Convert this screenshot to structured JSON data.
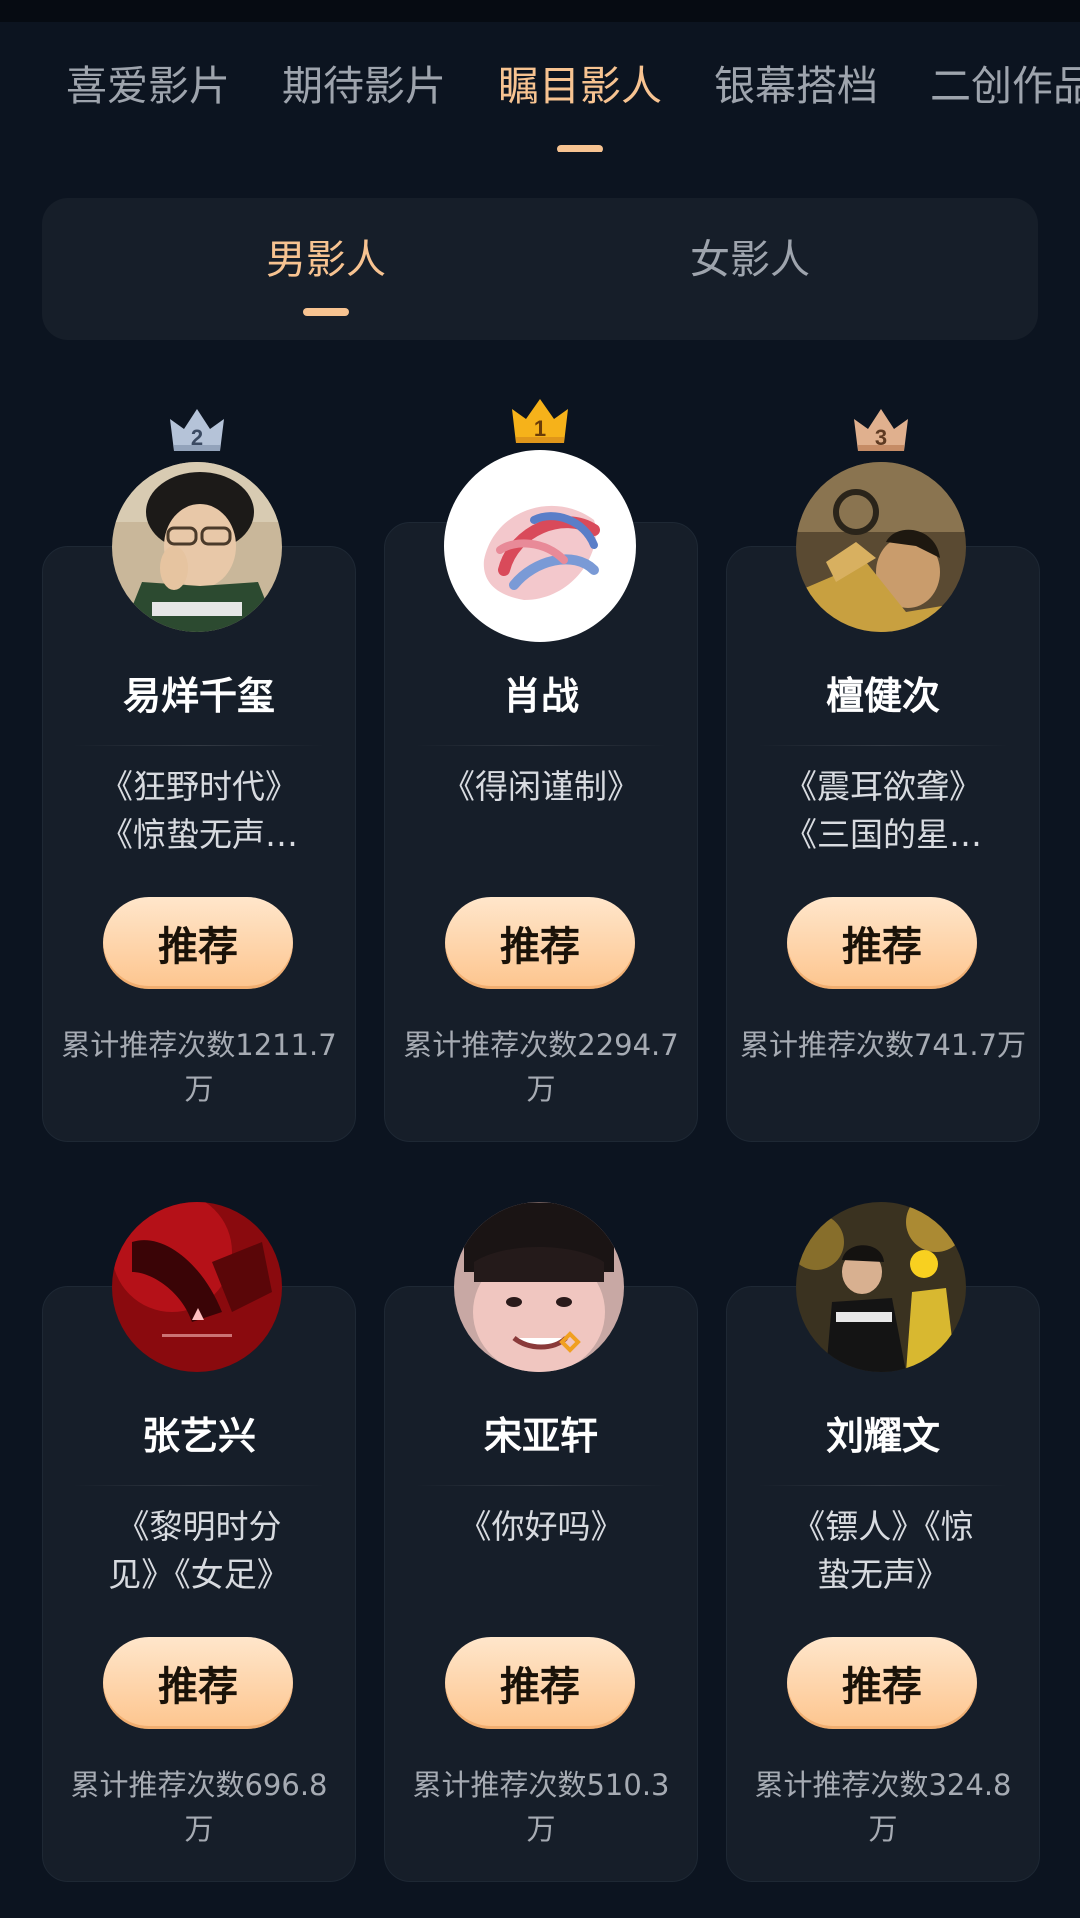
{
  "top_tabs": [
    {
      "label": "喜爱影片",
      "active": false
    },
    {
      "label": "期待影片",
      "active": false
    },
    {
      "label": "瞩目影人",
      "active": true
    },
    {
      "label": "银幕搭档",
      "active": false
    },
    {
      "label": "二创作品",
      "active": false
    }
  ],
  "segment": {
    "items": [
      {
        "label": "男影人",
        "active": true
      },
      {
        "label": "女影人",
        "active": false
      }
    ]
  },
  "recommend_label": "推荐",
  "cards": [
    {
      "rank": "2",
      "name": "易烊千玺",
      "works": [
        "《狂野时代》",
        "《惊蛰无声…"
      ],
      "count": [
        "累计推荐次数1211.7",
        "万"
      ]
    },
    {
      "rank": "1",
      "name": "肖战",
      "works": [
        "《得闲谨制》"
      ],
      "count": [
        "累计推荐次数2294.7",
        "万"
      ]
    },
    {
      "rank": "3",
      "name": "檀健次",
      "works": [
        "《震耳欲聋》",
        "《三国的星…"
      ],
      "count": [
        "累计推荐次数741.7万"
      ]
    },
    {
      "rank": "",
      "name": "张艺兴",
      "works": [
        "《黎明时分",
        "见》《女足》"
      ],
      "count": [
        "累计推荐次数696.8",
        "万"
      ]
    },
    {
      "rank": "",
      "name": "宋亚轩",
      "works": [
        "《你好吗》"
      ],
      "count": [
        "累计推荐次数510.3",
        "万"
      ]
    },
    {
      "rank": "",
      "name": "刘耀文",
      "works": [
        "《镖人》《惊",
        "蛰无声》"
      ],
      "count": [
        "累计推荐次数324.8",
        "万"
      ]
    }
  ],
  "colors": {
    "background": "#0c1420",
    "card": "#161e29",
    "accent": "#f7c391",
    "inactive_text": "#9ea4ad",
    "crown_gold": "#f6b21a",
    "crown_silver": "#b5c3d8",
    "crown_bronze": "#e0b08e"
  },
  "icons": {
    "crown_first": "crown-icon",
    "crown_second": "crown-icon",
    "crown_third": "crown-icon"
  }
}
